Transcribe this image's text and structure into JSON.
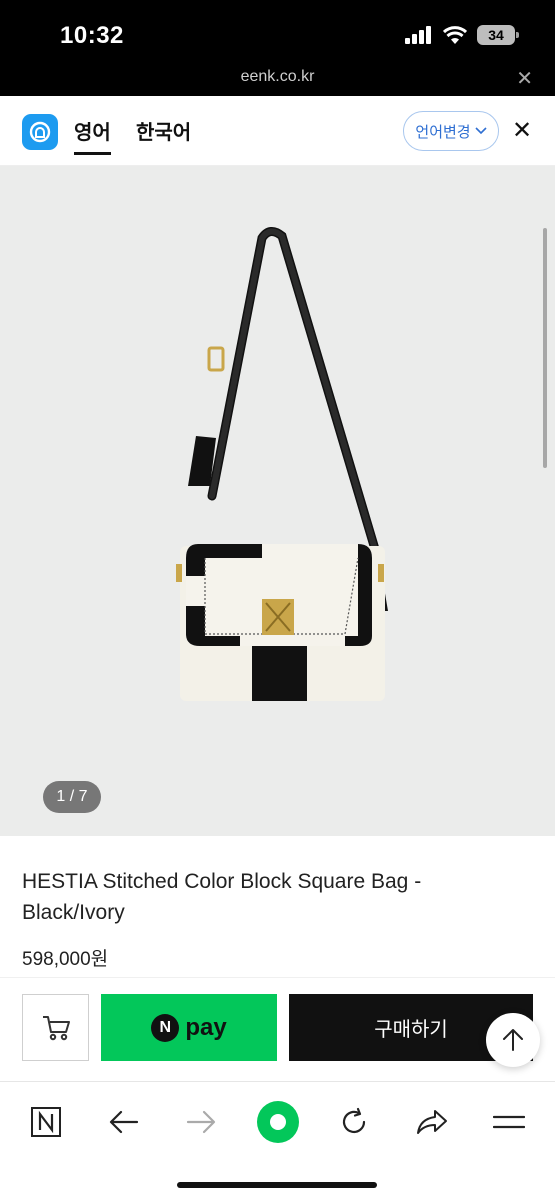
{
  "status": {
    "time": "10:32",
    "battery": "34"
  },
  "browser": {
    "url": "eenk.co.kr"
  },
  "translate": {
    "lang_primary": "영어",
    "lang_secondary": "한국어",
    "change_language": "언어변경"
  },
  "product": {
    "image_counter": "1 / 7",
    "title": "HESTIA Stitched Color Block Square Bag - Black/Ivory",
    "price": "598,000원"
  },
  "actions": {
    "npay_badge": "N",
    "npay_label": "pay",
    "purchase_label": "구매하기"
  },
  "colors": {
    "npay_green": "#03c75a",
    "papago_blue": "#1d9bf0",
    "purchase_black": "#111111"
  },
  "icons": [
    "signal-icon",
    "wifi-icon",
    "battery-icon",
    "close-icon",
    "papago-logo-icon",
    "chevron-down-icon",
    "cart-icon",
    "arrow-up-icon",
    "naver-n-icon",
    "back-arrow-icon",
    "forward-arrow-icon",
    "green-dot-icon",
    "reload-icon",
    "share-icon",
    "menu-icon"
  ]
}
